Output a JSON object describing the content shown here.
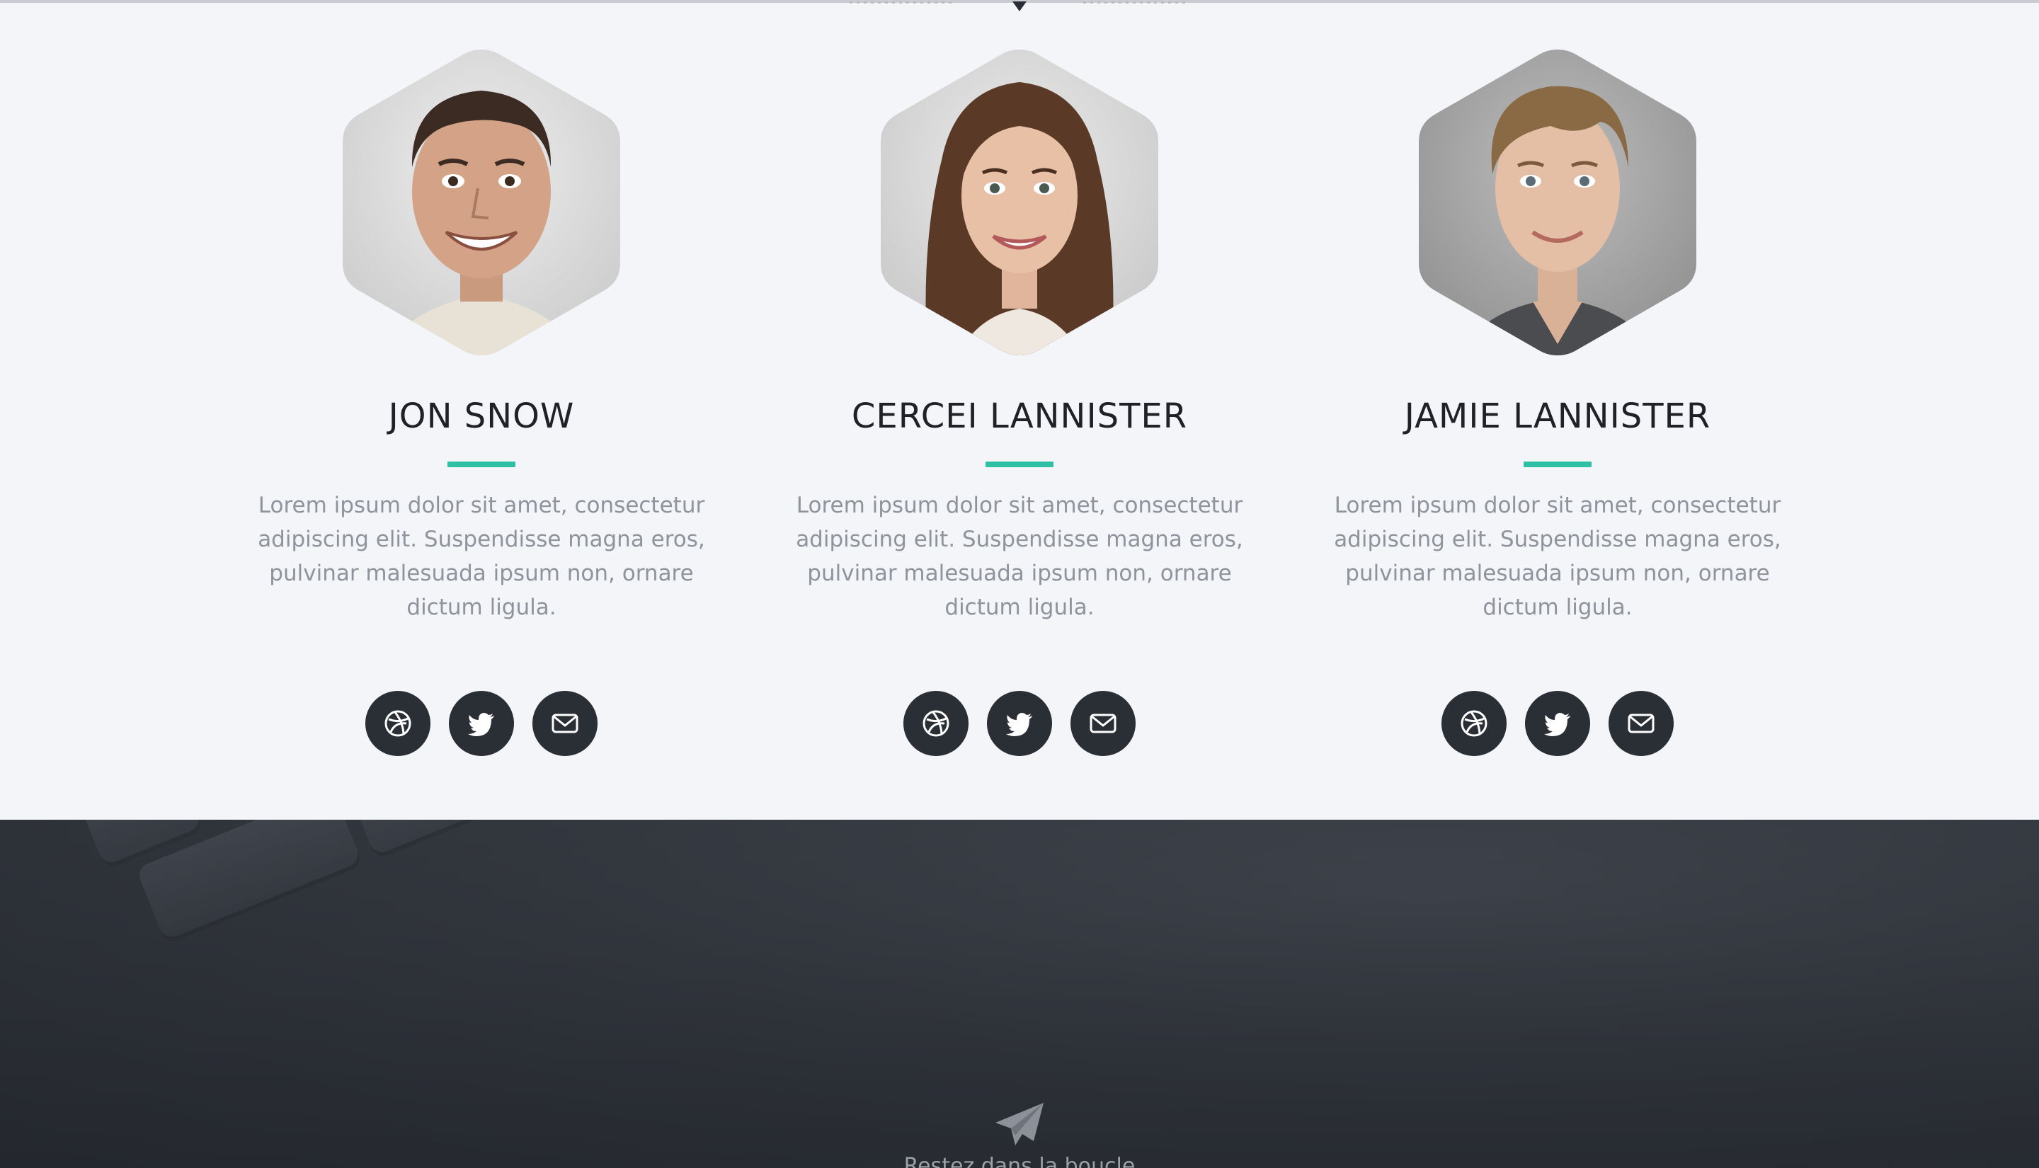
{
  "team": {
    "members": [
      {
        "name": "JON SNOW",
        "bio": "Lorem ipsum dolor sit amet, consectetur adipiscing elit. Suspendisse magna eros, pulvinar malesuada ipsum non, ornare dictum ligula.",
        "photo_icon": "portrait-man-smiling",
        "social": [
          "dribbble-icon",
          "twitter-icon",
          "mail-icon"
        ]
      },
      {
        "name": "CERCEI LANNISTER",
        "bio": "Lorem ipsum dolor sit amet, consectetur adipiscing elit. Suspendisse magna eros, pulvinar malesuada ipsum non, ornare dictum ligula.",
        "photo_icon": "portrait-woman-smiling",
        "social": [
          "dribbble-icon",
          "twitter-icon",
          "mail-icon"
        ]
      },
      {
        "name": "JAMIE LANNISTER",
        "bio": "Lorem ipsum dolor sit amet, consectetur adipiscing elit. Suspendisse magna eros, pulvinar malesuada ipsum non, ornare dictum ligula.",
        "photo_icon": "portrait-young-man",
        "social": [
          "dribbble-icon",
          "twitter-icon",
          "mail-icon"
        ]
      }
    ]
  },
  "newsletter": {
    "icon": "paper-plane-icon",
    "label": "Restez dans la boucle"
  },
  "colors": {
    "accent": "#2fbfa5",
    "background": "#f4f5f9",
    "social_button": "#2a2e35",
    "heading": "#1f2126",
    "body_text": "#8f939b",
    "band": "#3a3e46"
  }
}
